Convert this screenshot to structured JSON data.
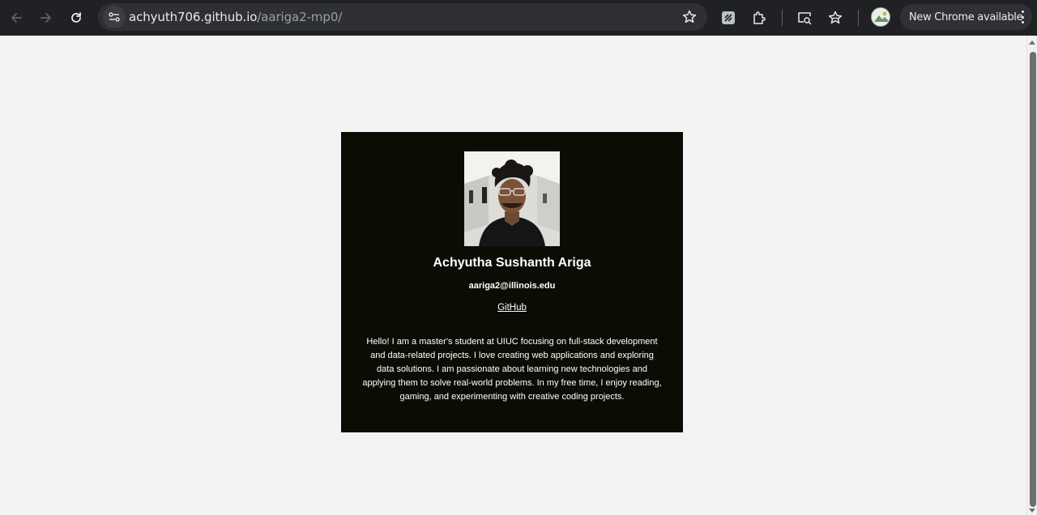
{
  "browser": {
    "url_host": "achyuth706.github.io",
    "url_path": "/aariga2-mp0/",
    "update_label": "New Chrome available",
    "icons": [
      "back-icon",
      "forward-icon",
      "reload-icon",
      "tune-icon",
      "bookmark-star-icon",
      "extension-app-icon",
      "extensions-puzzle-icon",
      "screen-search-icon",
      "bookmarks-icon",
      "profile-avatar",
      "more-menu-icon"
    ]
  },
  "profile": {
    "name": "Achyutha Sushanth Ariga",
    "email": "aariga2@illinois.edu",
    "link_label": "GitHub",
    "bio": "Hello! I am a master's student at UIUC focusing on full-stack development and data-related projects. I love creating web applications and exploring data solutions. I am passionate about learning new technologies and applying them to solve real-world problems. In my free time, I enjoy reading, gaming, and experimenting with creative coding projects."
  },
  "colors": {
    "page_background": "#f3f3f3",
    "card_background": "#0b0d05",
    "text": "#ffffff",
    "toolbar": "#202124"
  }
}
